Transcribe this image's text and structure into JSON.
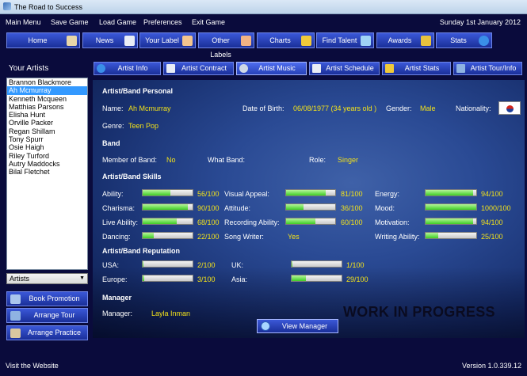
{
  "window": {
    "title": "The Road to Success"
  },
  "menu": [
    "Main Menu",
    "Save Game",
    "Load Game",
    "Preferences",
    "Exit Game"
  ],
  "date": "Sunday 1st January 2012",
  "nav": [
    {
      "label": "Home",
      "icon": "house-icon",
      "color": "#e8d6a8"
    },
    {
      "label": "News",
      "icon": "newspaper-icon",
      "color": "#e9edf6"
    },
    {
      "label": "Your Label",
      "icon": "person-icon",
      "color": "#f3c58e"
    },
    {
      "label": "Other Labels",
      "icon": "people-icon",
      "color": "#f1b384"
    },
    {
      "label": "Charts",
      "icon": "chart-icon",
      "color": "#f0c93a"
    },
    {
      "label": "Find Talent",
      "icon": "magnifier-icon",
      "color": "#9fd3f5"
    },
    {
      "label": "Awards",
      "icon": "trophy-icon",
      "color": "#e8c23d"
    },
    {
      "label": "Stats",
      "icon": "info-icon",
      "color": "#3a8fe8"
    }
  ],
  "left_panel": {
    "title": "Your Artists",
    "artists": [
      "Brannon Blackmore",
      "Ah Mcmurray",
      "Kenneth Mcqueen",
      "Matthias Parsons",
      "Elisha Hunt",
      "Orville Packer",
      "Regan Shillam",
      "Tony Spurr",
      "Osie Haigh",
      "Riley Turford",
      "Autry Maddocks",
      "Bilal Fletchet"
    ],
    "selected_index": 1,
    "filter": "Artists",
    "buttons": [
      "Book Promotion",
      "Arrange Tour",
      "Arrange Practice"
    ]
  },
  "tabs": [
    "Artist Info",
    "Artist Contract",
    "Artist Music",
    "Artist Schedule",
    "Artist Stats",
    "Artist Tour/Info"
  ],
  "active_tab": "Artist Music",
  "personal": {
    "section": "Artist/Band Personal",
    "name_label": "Name:",
    "name": "Ah Mcmurray",
    "dob_label": "Date of Birth:",
    "dob": "06/08/1977 (34 years old )",
    "gender_label": "Gender:",
    "gender": "Male",
    "nationality_label": "Nationality:",
    "genre_label": "Genre:",
    "genre": "Teen Pop"
  },
  "band": {
    "section": "Band",
    "member_label": "Member of Band:",
    "member": "No",
    "what_label": "What Band:",
    "what": "",
    "role_label": "Role:",
    "role": "Singer"
  },
  "skills": {
    "section": "Artist/Band Skills",
    "items": [
      {
        "label": "Ability:",
        "text": "56/100",
        "value": 56,
        "max": 100
      },
      {
        "label": "Visual Appeal:",
        "text": "81/100",
        "value": 81,
        "max": 100
      },
      {
        "label": "Energy:",
        "text": "94/100",
        "value": 94,
        "max": 100
      },
      {
        "label": "Charisma:",
        "text": "90/100",
        "value": 90,
        "max": 100
      },
      {
        "label": "Attitude:",
        "text": "36/100",
        "value": 36,
        "max": 100
      },
      {
        "label": "Mood:",
        "text": "1000/100",
        "value": 1000,
        "max": 100
      },
      {
        "label": "Live Ability:",
        "text": "68/100",
        "value": 68,
        "max": 100
      },
      {
        "label": "Recording Ability:",
        "text": "60/100",
        "value": 60,
        "max": 100
      },
      {
        "label": "Motivation:",
        "text": "94/100",
        "value": 94,
        "max": 100
      },
      {
        "label": "Dancing:",
        "text": "22/100",
        "value": 22,
        "max": 100
      },
      {
        "label": "Song Writer:",
        "text": "Yes"
      },
      {
        "label": "Writing Ability:",
        "text": "25/100",
        "value": 25,
        "max": 100
      }
    ]
  },
  "reputation": {
    "section": "Artist/Band Reputation",
    "items": [
      {
        "label": "USA:",
        "text": "2/100",
        "value": 2,
        "max": 100
      },
      {
        "label": "UK:",
        "text": "1/100",
        "value": 1,
        "max": 100
      },
      {
        "label": "Europe:",
        "text": "3/100",
        "value": 3,
        "max": 100
      },
      {
        "label": "Asia:",
        "text": "29/100",
        "value": 29,
        "max": 100
      }
    ]
  },
  "manager": {
    "section": "Manager",
    "label": "Manager:",
    "name": "Layla Inman",
    "button": "View Manager"
  },
  "wip": "WORK IN PROGRESS",
  "footer": {
    "link": "Visit the Website",
    "version": "Version 1.0.339.12"
  }
}
